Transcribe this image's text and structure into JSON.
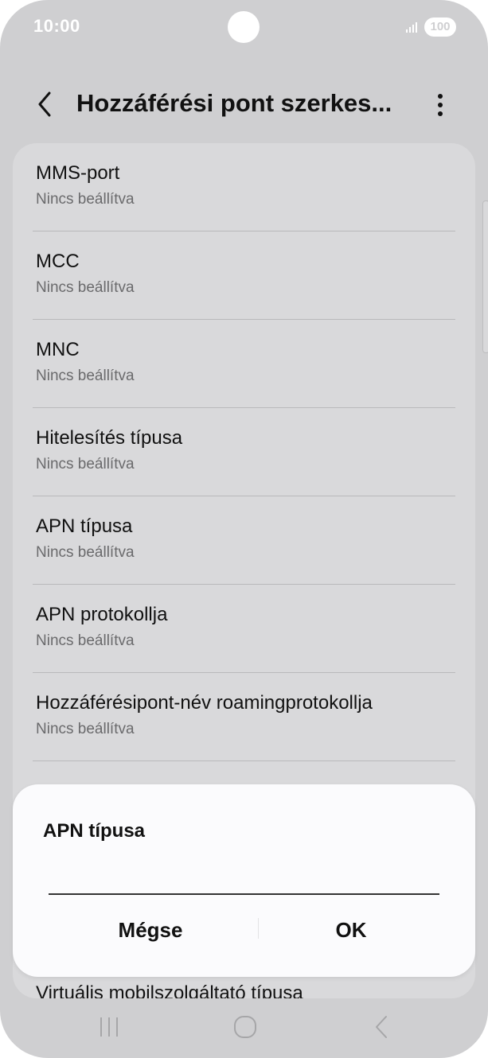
{
  "status_bar": {
    "time": "10:00",
    "battery": "100"
  },
  "app_bar": {
    "title": "Hozzáférési pont szerkes...",
    "back_icon": "chevron-left-icon",
    "more_icon": "more-vert-icon"
  },
  "settings": [
    {
      "title": "MMS-port",
      "value": "Nincs beállítva"
    },
    {
      "title": "MCC",
      "value": "Nincs beállítva"
    },
    {
      "title": "MNC",
      "value": "Nincs beállítva"
    },
    {
      "title": "Hitelesítés típusa",
      "value": "Nincs beállítva"
    },
    {
      "title": "APN típusa",
      "value": "Nincs beállítva"
    },
    {
      "title": "APN protokollja",
      "value": "Nincs beállítva"
    },
    {
      "title": "Hozzáférésipont-név roamingprotokollja",
      "value": "Nincs beállítva"
    }
  ],
  "partial_item": "Virtuális mobilszolgáltató típusa",
  "dialog": {
    "title": "APN típusa",
    "input_value": "",
    "cancel_label": "Mégse",
    "ok_label": "OK"
  },
  "nav_bar": {
    "recent_icon": "recent-apps-icon",
    "home_icon": "home-icon",
    "back_icon": "back-icon"
  },
  "colors": {
    "dim_background": "#cfcfd1",
    "card": "#d9d9db",
    "dialog": "#fbfbfd"
  }
}
